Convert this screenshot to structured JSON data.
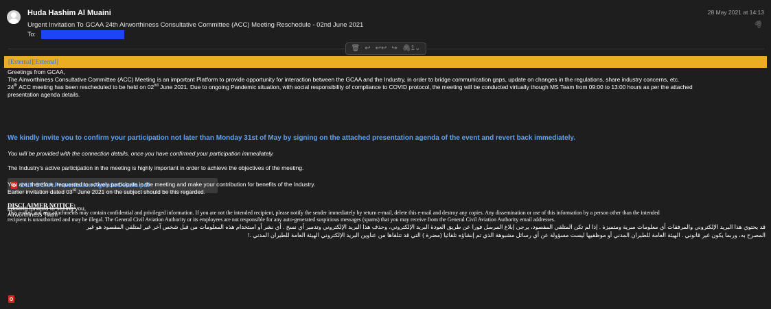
{
  "header": {
    "sender": "Huda Hashim Al Muaini",
    "subject": "Urgent Invitation To GCAA 24th Airworthiness Consultative Committee (ACC) Meeting Reschedule - 02nd June 2021",
    "to_label": "To:",
    "date": "28 May 2021 at 14:13",
    "paperclip_icon": "paperclip-icon"
  },
  "toolbar": {
    "trash_icon": "🗑",
    "reply_icon": "↩",
    "reply_all_icon": "↩↩",
    "forward_icon": "↪",
    "attachments_label": "1"
  },
  "banner": {
    "color": "#ecad23",
    "tag": "[External][External]"
  },
  "body": {
    "greeting": "Greetings from GCAA,",
    "p1": "The Airworthiness Consultative Committee (ACC) Meeting is an important Platform to provide opportunity for interaction between the GCAA and the Industry, in order to bridge communication gaps, update on changes in the regulations, share industry concerns, etc.",
    "p2_a": "24",
    "p2_sup1": "th",
    "p2_b": " ACC meeting has been rescheduled to be held on 02",
    "p2_sup2": "nd",
    "p2_c": " June 2021.  Due to ongoing Pandemic situation, with social responsibility of compliance to COVID protocol, the meeting will be conducted virtually though MS Team from 09:00 to 13:00 hours as per the attached",
    "p2_d": "presentation agenda details.",
    "attachment_name": "24th GCAA Presentation Agenda Details.pdf",
    "invite": "We kindly invite you to confirm your participation not later than Monday 31st of May by signing on the attached presentation agenda of the event and revert back immediately.",
    "connection": "You will be provided with the connection details, once you have confirmed your participation immediately.",
    "industry": "The Industry's active participation in the meeting is highly important in order to achieve the objectives of the meeting.",
    "request": "You are, therefore, requested to actively participate in the meeting and make your contribution for benefits of the Industry.",
    "earlier_a": "Earlier invitation dated 03",
    "earlier_sup": "rd",
    "earlier_b": " June 2021 on the subject should be this regarded.",
    "closing": "Looking forward to seeing you,",
    "team": "Airworthiness Team",
    "arabic_1": "قد يحتوي هذا البريد الإلكتروني والمرفقات أي معلومات سرية ومتميزة . إذا لم تكن المتلقي المقصود، يرجى إبلاغ المرسل فورا عن طريق العودة البريد الإلكتروني، وحذف هذا البريد الإلكتروني وتدمير أي نسخ . أي نشر أو استخدام هذه المعلومات من قبل شخص آخر غير لمتلقي المقصود هو غير",
    "arabic_2": "المصرح به، وربما يكون غير قانوني . الهيئة العامة للطيران المدني أو موظفيها ليست مسؤولة عن أي رسائل مشبوهة الذي تم إنشاؤه تلقائيا (مضرة ) التي قد تتلقاها من عناوين البريد الإلكتروني الهيئة العامة للطيران المدني .!",
    "disclaimer_title": "DISCLAIMER NOTICE:",
    "disclaimer_1": "This e-mail and any attachments may contain confidential and privileged information. If you are not the intended recipient, please notify the sender immediately by return e-mail, delete this e-mail and destroy any copies. Any dissemination or use of this information by a person other than the intended",
    "disclaimer_2": "recipient is unauthorized and may be illegal. The General Civil Aviation Authority or its employees are not responsible for any auto-generated suspicious messages (spams) that you may receive from the General Civil Aviation Authority email addresses."
  }
}
